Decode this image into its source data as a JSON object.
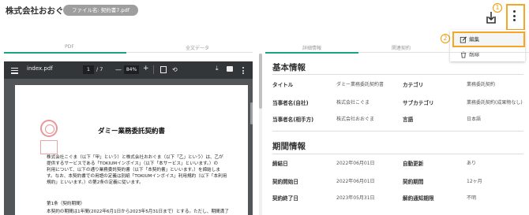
{
  "header": {
    "company": "株式会社おおぐま",
    "file_label": "ファイル名: 契約書7.pdf"
  },
  "badges": {
    "one": "1",
    "two": "2"
  },
  "menu": {
    "edit": "編集",
    "delete": "削除"
  },
  "tabs_left": [
    "PDF",
    "全文データ"
  ],
  "tabs_right": [
    "詳細情報",
    "関連契約"
  ],
  "viewer": {
    "filename": "index.pdf",
    "page_current": "1",
    "page_total": "/ 7",
    "zoom": "84%",
    "zoom_minus": "—",
    "zoom_plus": "+"
  },
  "document": {
    "title": "ダミー業務委託契約書",
    "line1": "株式会社こぐま（以下「甲」という）と株式会社おおぐま（以下「乙」という）は、乙が",
    "line2": "提供するサービスである「TOKIUMインボイス」（以下「本サービス」といいます。）の",
    "line3": "利用について、以下の通り業務委託契約書（以下「本契約書」といいます。）を締結しま",
    "line4": "す。なお、本契約書での用語の定義は別紙「TOKIUMインボイス」利用規約（以下「本利用",
    "line5": "規約」といいます。）の第2条の定義に従います。",
    "sec1": "第1条（契約期間）",
    "sec2": "本契約の期間は1年間(2022年6月1日から2023年5月31日まで）とする。ただし、期間満了"
  },
  "basic": {
    "title": "基本情報",
    "title_label": "タイトル",
    "title_value": "ダミー業務委託契約書",
    "category_label": "カテゴリ",
    "category_value": "業務委託契約",
    "party_self_label": "当事者名(自社)",
    "party_self_value": "株式会社こぐま",
    "subcategory_label": "サブカテゴリ",
    "subcategory_value": "業務委託契約(成果物なし)",
    "party_other_label": "当事者名(相手方)",
    "party_other_value": "株式会社おおぐま",
    "language_label": "言語",
    "language_value": "日本語"
  },
  "period": {
    "title": "期間情報",
    "signed_label": "締結日",
    "signed_value": "2022年06月01日",
    "auto_renew_label": "自動更新",
    "auto_renew_value": "あり",
    "start_label": "契約開始日",
    "start_value": "2022年06月01日",
    "term_label": "契約期間",
    "term_value": "12ヶ月",
    "end_label": "契約終了日",
    "end_value": "2023年05月31日",
    "cancel_label": "解約通知期限",
    "cancel_value": "不明"
  },
  "colors": {
    "accent": "#1aa38a",
    "highlight": "#f5a623",
    "badge": "#f39800",
    "stamp": "#e57373"
  }
}
